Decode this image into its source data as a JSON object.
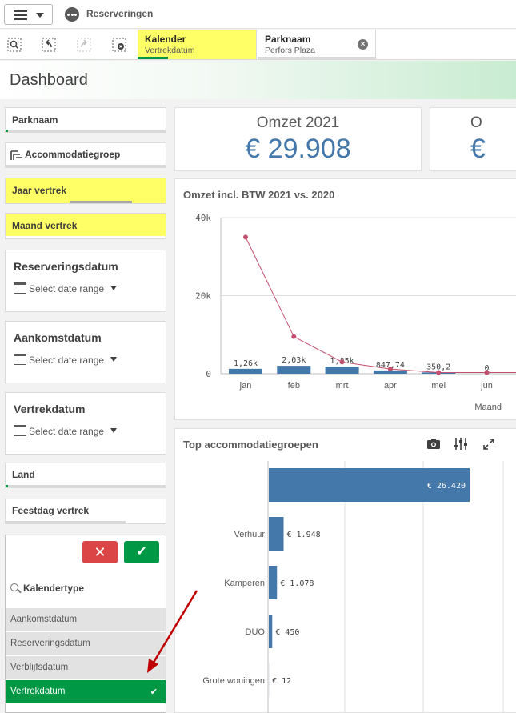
{
  "app": {
    "title": "Reserveringen"
  },
  "selections": [
    {
      "field": "Kalender",
      "value": "Vertrekdatum",
      "highlight": "#ffff66"
    },
    {
      "field": "Parknaam",
      "value": "Perfors Plaza"
    }
  ],
  "sheet": {
    "title": "Dashboard"
  },
  "filters": {
    "parknaam": "Parknaam",
    "accommodatiegroep": "Accommodatiegroep",
    "jaar_vertrek": "Jaar vertrek",
    "maand_vertrek": "Maand vertrek",
    "land": "Land",
    "feestdag_vertrek": "Feestdag vertrek"
  },
  "date_pickers": [
    {
      "title": "Reserveringsdatum",
      "placeholder": "Select date range"
    },
    {
      "title": "Aankomstdatum",
      "placeholder": "Select date range"
    },
    {
      "title": "Vertrekdatum",
      "placeholder": "Select date range"
    }
  ],
  "kalendertype": {
    "title": "Kalendertype",
    "items": [
      "Aankomstdatum",
      "Reserveringsdatum",
      "Verblijfsdatum",
      "Vertrekdatum"
    ],
    "selected": "Vertrekdatum",
    "check": "✔"
  },
  "kpis": [
    {
      "title": "Omzet 2021",
      "value": "€ 29.908"
    },
    {
      "title": "O",
      "value": "€"
    }
  ],
  "colors": {
    "accent": "#009845",
    "highlight": "#ffff66",
    "bar": "#4477aa",
    "line": "#c0506e",
    "danger": "#dc4545"
  },
  "chart_data": [
    {
      "type": "bar",
      "title": "Omzet incl. BTW 2021 vs. 2020",
      "xlabel": "Maand",
      "categories": [
        "jan",
        "feb",
        "mrt",
        "apr",
        "mei",
        "jun"
      ],
      "y_ticks": [
        "0",
        "20k",
        "40k"
      ],
      "ylim": [
        0,
        40000
      ],
      "series": [
        {
          "type": "bar",
          "values": [
            1260,
            2030,
            1850,
            847.74,
            350.2,
            0
          ],
          "labels": [
            "1,26k",
            "2,03k",
            "1,85k",
            "847,74",
            "350,2",
            "0"
          ]
        },
        {
          "type": "line",
          "values": [
            35000,
            9500,
            3000,
            1200,
            300,
            300
          ]
        }
      ]
    },
    {
      "type": "bar",
      "orientation": "horizontal",
      "title": "Top accommodatiegroepen",
      "categories": [
        "",
        "Verhuur",
        "Kamperen",
        "DUO",
        "Grote woningen"
      ],
      "values": [
        26420,
        1948,
        1078,
        450,
        12
      ],
      "labels": [
        "€ 26.420",
        "€ 1.948",
        "€ 1.078",
        "€ 450",
        "€ 12"
      ]
    }
  ]
}
